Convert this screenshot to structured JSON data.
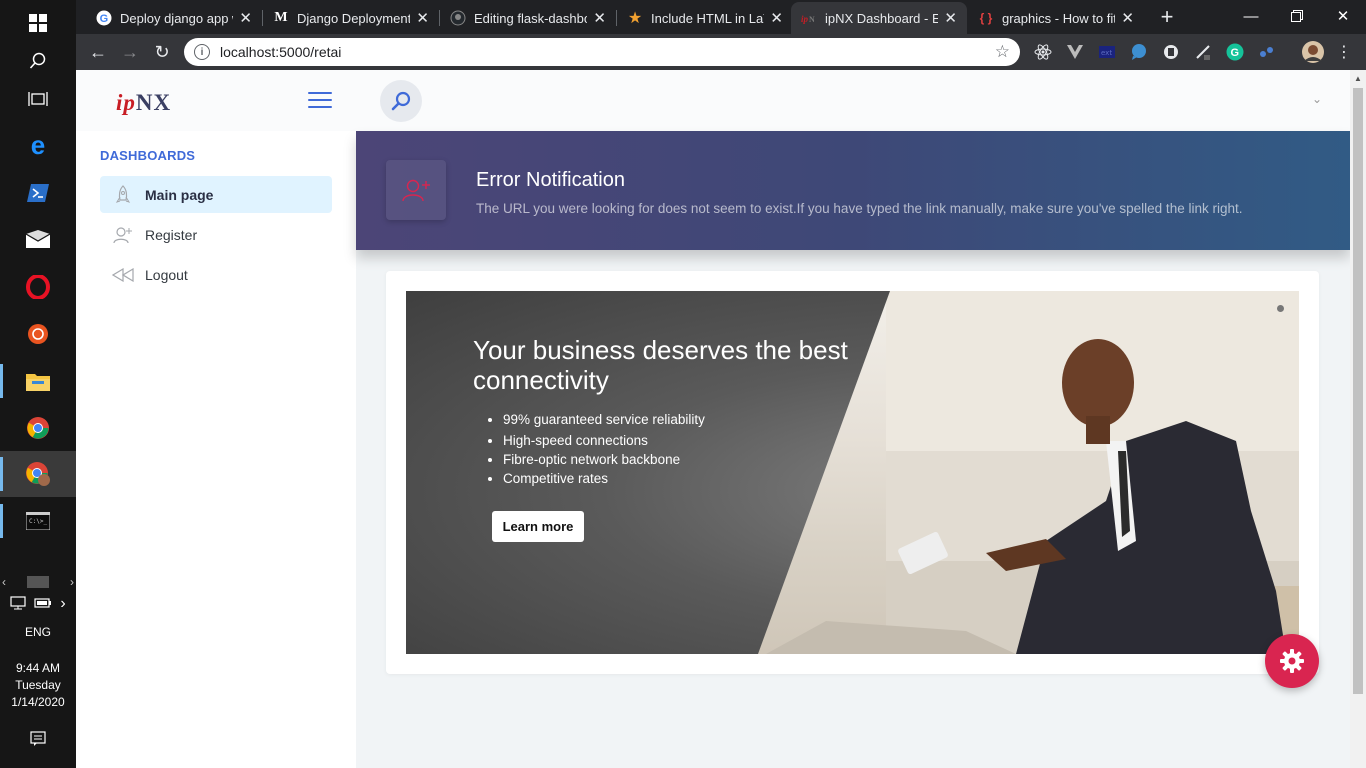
{
  "taskbar": {
    "icons": [
      "windows-icon",
      "search-icon",
      "task-view-icon",
      "edge-icon",
      "powershell-icon",
      "mail-icon",
      "opera-icon",
      "ubuntu-icon",
      "file-explorer-icon",
      "chrome-icon",
      "chrome-profile-icon",
      "terminal-icon"
    ],
    "language": "ENG",
    "time": "9:44 AM",
    "day": "Tuesday",
    "date": "1/14/2020"
  },
  "browser": {
    "tabs": [
      {
        "title": "Deploy django app w",
        "favicon": "google-icon",
        "fav_color": "#4285f4"
      },
      {
        "title": "Django Deployment (",
        "favicon": "medium-icon",
        "fav_color": "#ffffff"
      },
      {
        "title": "Editing flask-dashbo",
        "favicon": "github-icon",
        "fav_color": "#bbbbbb"
      },
      {
        "title": "Include HTML in LaTe",
        "favicon": "star-icon",
        "fav_color": "#f0a030"
      },
      {
        "title": "ipNX Dashboard - Err",
        "favicon": "ipnx-icon",
        "fav_color": "#c81d25"
      },
      {
        "title": "graphics - How to fit",
        "favicon": "braces-icon",
        "fav_color": "#e04040"
      }
    ],
    "active_tab": 4,
    "url": "localhost:5000/retai"
  },
  "app": {
    "logo_ip": "ip",
    "logo_nx": "NX",
    "sidebar": {
      "heading": "DASHBOARDS",
      "items": [
        {
          "label": "Main page",
          "icon": "rocket-icon",
          "active": true
        },
        {
          "label": "Register",
          "icon": "add-user-icon",
          "active": false
        },
        {
          "label": "Logout",
          "icon": "rewind-icon",
          "active": false
        }
      ]
    },
    "notification": {
      "title": "Error Notification",
      "message": "The URL you were looking for does not seem to exist.If you have typed the link manually, make sure you've spelled the link right."
    },
    "hero": {
      "heading": "Your business deserves the best connectivity",
      "bullets": [
        "99% guaranteed service reliability",
        "High-speed connections",
        "Fibre-optic network backbone",
        "Competitive rates"
      ],
      "button": "Learn more"
    },
    "colors": {
      "accent": "#3f6ad8",
      "fab": "#d92550",
      "banner_start": "#4c4577",
      "banner_end": "#315b85"
    }
  }
}
